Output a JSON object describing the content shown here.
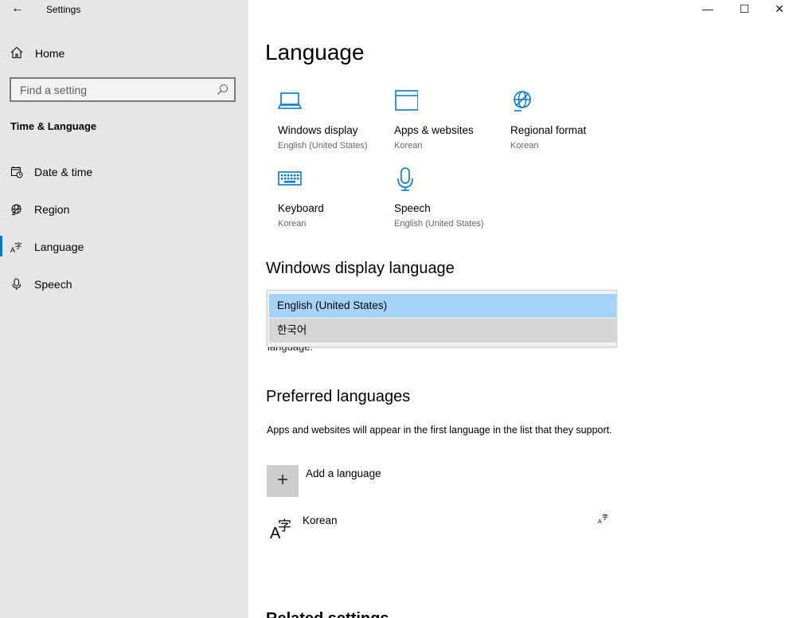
{
  "window": {
    "title": "Settings",
    "back_glyph": "←",
    "minimize_glyph": "—",
    "maximize_glyph": "☐",
    "close_glyph": "✕"
  },
  "sidebar": {
    "home_label": "Home",
    "search_placeholder": "Find a setting",
    "section_title": "Time & Language",
    "items": [
      {
        "label": "Date & time",
        "icon": "calendar-clock-icon"
      },
      {
        "label": "Region",
        "icon": "globe-icon"
      },
      {
        "label": "Language",
        "icon": "language-icon",
        "active": true
      },
      {
        "label": "Speech",
        "icon": "microphone-icon"
      }
    ]
  },
  "main": {
    "title": "Language",
    "tiles": [
      {
        "name": "Windows display",
        "sub": "English (United States)",
        "icon": "laptop-icon"
      },
      {
        "name": "Apps & websites",
        "sub": "Korean",
        "icon": "browser-window-icon"
      },
      {
        "name": "Regional format",
        "sub": "Korean",
        "icon": "globe-icon"
      },
      {
        "name": "Keyboard",
        "sub": "Korean",
        "icon": "keyboard-icon"
      },
      {
        "name": "Speech",
        "sub": "English (United States)",
        "icon": "microphone-icon"
      }
    ],
    "display_language": {
      "heading": "Windows display language",
      "options": [
        "English (United States)",
        "한국어"
      ],
      "selected": "English (United States)",
      "partial_text": "language."
    },
    "preferred": {
      "heading": "Preferred languages",
      "description": "Apps and websites will appear in the first language in the list that they support.",
      "add_label": "Add a language",
      "add_glyph": "+",
      "languages": [
        {
          "label": "Korean"
        }
      ]
    },
    "related_heading": "Related settings"
  },
  "colors": {
    "accent": "#0078d4",
    "sidebar_bg": "#e6e6e6",
    "selected_option_bg": "#a6d3f8"
  }
}
